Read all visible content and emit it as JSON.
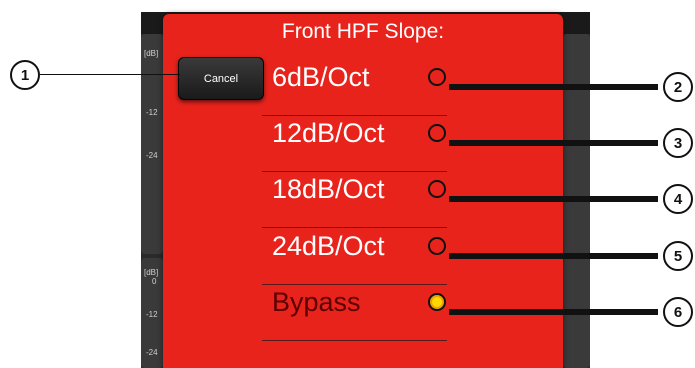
{
  "modal": {
    "title": "Front HPF Slope:"
  },
  "cancel_label": "Cancel",
  "options": [
    {
      "label": "6dB/Oct",
      "selected": false
    },
    {
      "label": "12dB/Oct",
      "selected": false
    },
    {
      "label": "18dB/Oct",
      "selected": false
    },
    {
      "label": "24dB/Oct",
      "selected": false
    },
    {
      "label": "Bypass",
      "selected": true
    }
  ],
  "background": {
    "db_label_top": "[dB]",
    "db_label_bottom": "[dB]",
    "tick_12_top": "-12",
    "tick_24_top": "-24",
    "tick_12_bottom": "-12",
    "tick_24_bottom": "-24",
    "tick_0_bottom": "0"
  },
  "callouts": [
    "1",
    "2",
    "3",
    "4",
    "5",
    "6"
  ],
  "colors": {
    "modal_red": "#e8231c",
    "selected_radio": "#ffd800"
  }
}
